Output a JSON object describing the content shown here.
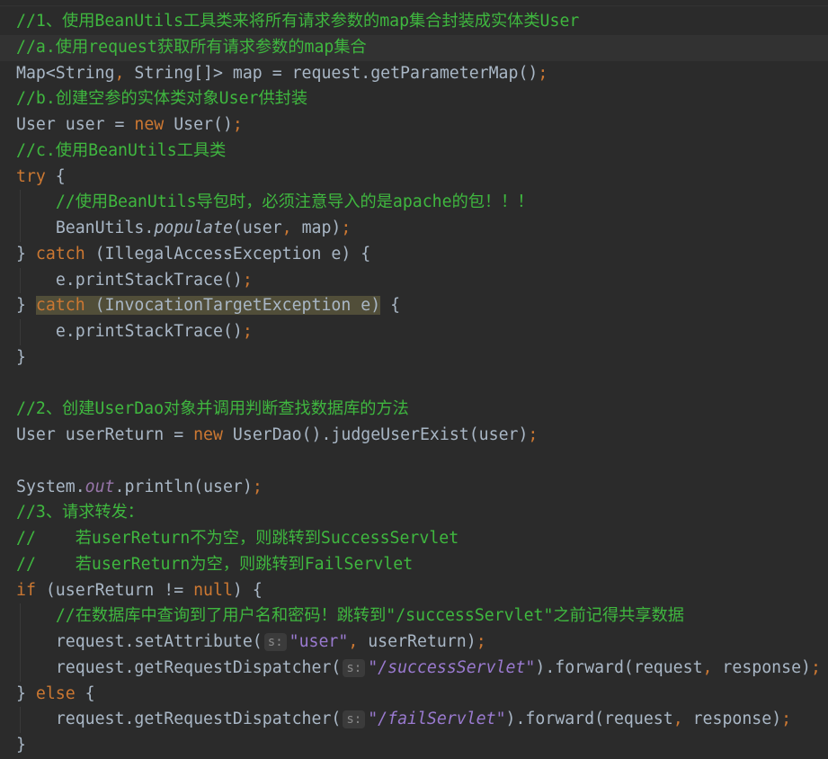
{
  "editor": {
    "current_line": 2,
    "lines": [
      {
        "indent": 0,
        "tokens": [
          [
            "cm",
            "//1、使用BeanUtils工具类来将所有请求参数的map集合封装成实体类User"
          ]
        ]
      },
      {
        "indent": 0,
        "tokens": [
          [
            "cm",
            "//a.使用request获取所有请求参数的map集合"
          ]
        ]
      },
      {
        "indent": 0,
        "tokens": [
          [
            "",
            "Map<String"
          ],
          [
            "pun",
            ","
          ],
          [
            "",
            " String[]> map = request.getParameterMap()"
          ],
          [
            "pun",
            ";"
          ]
        ]
      },
      {
        "indent": 0,
        "tokens": [
          [
            "cm",
            "//b.创建空参的实体类对象User供封装"
          ]
        ]
      },
      {
        "indent": 0,
        "tokens": [
          [
            "",
            "User user = "
          ],
          [
            "kw",
            "new"
          ],
          [
            "",
            " User()"
          ],
          [
            "pun",
            ";"
          ]
        ]
      },
      {
        "indent": 0,
        "tokens": [
          [
            "cm",
            "//c.使用BeanUtils工具类"
          ]
        ]
      },
      {
        "indent": 0,
        "tokens": [
          [
            "kw",
            "try"
          ],
          [
            "",
            " {"
          ]
        ]
      },
      {
        "indent": 1,
        "tokens": [
          [
            "cm",
            "//使用BeanUtils导包时，必须注意导入的是apache的包！！！"
          ]
        ]
      },
      {
        "indent": 1,
        "tokens": [
          [
            "",
            "BeanUtils."
          ],
          [
            "it",
            "populate"
          ],
          [
            "",
            "(user"
          ],
          [
            "pun",
            ","
          ],
          [
            "",
            " map)"
          ],
          [
            "pun",
            ";"
          ]
        ]
      },
      {
        "indent": 0,
        "tokens": [
          [
            "",
            "} "
          ],
          [
            "kw",
            "catch"
          ],
          [
            "",
            " (IllegalAccessException e) {"
          ]
        ]
      },
      {
        "indent": 1,
        "tokens": [
          [
            "",
            "e.printStackTrace()"
          ],
          [
            "pun",
            ";"
          ]
        ]
      },
      {
        "indent": 0,
        "tokens": [
          [
            "",
            "} "
          ],
          [
            "kw hl",
            "catch"
          ],
          [
            "hl",
            " (InvocationTargetException e)"
          ],
          [
            "",
            " {"
          ]
        ]
      },
      {
        "indent": 1,
        "tokens": [
          [
            "",
            "e.printStackTrace()"
          ],
          [
            "pun",
            ";"
          ]
        ]
      },
      {
        "indent": 0,
        "tokens": [
          [
            "",
            "}"
          ]
        ]
      },
      {
        "indent": 0,
        "tokens": []
      },
      {
        "indent": 0,
        "tokens": [
          [
            "cm",
            "//2、创建UserDao对象并调用判断查找数据库的方法"
          ]
        ]
      },
      {
        "indent": 0,
        "tokens": [
          [
            "",
            "User userReturn = "
          ],
          [
            "kw",
            "new"
          ],
          [
            "",
            " UserDao().judgeUserExist(user)"
          ],
          [
            "pun",
            ";"
          ]
        ]
      },
      {
        "indent": 0,
        "tokens": []
      },
      {
        "indent": 0,
        "tokens": [
          [
            "",
            "System."
          ],
          [
            "fld",
            "out"
          ],
          [
            "",
            ".println(user)"
          ],
          [
            "pun",
            ";"
          ]
        ]
      },
      {
        "indent": 0,
        "tokens": [
          [
            "cm",
            "//3、请求转发："
          ]
        ]
      },
      {
        "indent": 0,
        "tokens": [
          [
            "cm",
            "//    若userReturn不为空，则跳转到SuccessServlet"
          ]
        ]
      },
      {
        "indent": 0,
        "tokens": [
          [
            "cm",
            "//    若userReturn为空，则跳转到FailServlet"
          ]
        ]
      },
      {
        "indent": 0,
        "tokens": [
          [
            "kw",
            "if"
          ],
          [
            "",
            " (userReturn != "
          ],
          [
            "kw",
            "null"
          ],
          [
            "",
            ") {"
          ]
        ]
      },
      {
        "indent": 1,
        "tokens": [
          [
            "cm",
            "//在数据库中查询到了用户名和密码！跳转到\"/successServlet\"之前记得共享数据"
          ]
        ]
      },
      {
        "indent": 1,
        "tokens": [
          [
            "",
            "request.setAttribute("
          ],
          [
            "hint",
            "s:"
          ],
          [
            "str",
            "\"user\""
          ],
          [
            "pun",
            ","
          ],
          [
            "",
            " userReturn)"
          ],
          [
            "pun",
            ";"
          ]
        ]
      },
      {
        "indent": 1,
        "tokens": [
          [
            "",
            "request.getRequestDispatcher("
          ],
          [
            "hint",
            "s:"
          ],
          [
            "str",
            "\""
          ],
          [
            "stri",
            "/successServlet"
          ],
          [
            "str",
            "\""
          ],
          [
            "",
            ").forward(request"
          ],
          [
            "pun",
            ","
          ],
          [
            "",
            " response)"
          ],
          [
            "pun",
            ";"
          ]
        ]
      },
      {
        "indent": 0,
        "tokens": [
          [
            "",
            "} "
          ],
          [
            "kw",
            "else"
          ],
          [
            "",
            " {"
          ]
        ]
      },
      {
        "indent": 1,
        "tokens": [
          [
            "",
            "request.getRequestDispatcher("
          ],
          [
            "hint",
            "s:"
          ],
          [
            "str",
            "\""
          ],
          [
            "stri",
            "/failServlet"
          ],
          [
            "str",
            "\""
          ],
          [
            "",
            ").forward(request"
          ],
          [
            "pun",
            ","
          ],
          [
            "",
            " response)"
          ],
          [
            "pun",
            ";"
          ]
        ]
      },
      {
        "indent": 0,
        "tokens": [
          [
            "",
            "}"
          ]
        ]
      }
    ]
  }
}
